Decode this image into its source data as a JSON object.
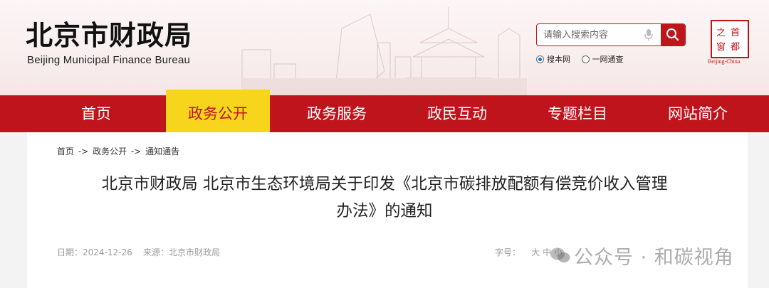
{
  "header": {
    "title": "北京市财政局",
    "subtitle": "Beijing Municipal Finance Bureau",
    "search_placeholder": "请输入搜索内容",
    "radios": [
      "搜本网",
      "一网通查"
    ],
    "seal_chars": [
      "首",
      "都",
      "之",
      "窗"
    ],
    "seal_caption": "Beijing-China"
  },
  "nav": {
    "items": [
      "首页",
      "政务公开",
      "政务服务",
      "政民互动",
      "专题栏目",
      "网站简介"
    ],
    "active_index": 1
  },
  "breadcrumb": {
    "home": "首页",
    "sep": "->",
    "level1": "政务公开",
    "level2": "通知通告"
  },
  "article": {
    "title_line1": "北京市财政局 北京市生态环境局关于印发《北京市碳排放配额有偿竞价收入管理",
    "title_line2": "办法》的通知",
    "date_label": "日期：",
    "date": "2024-12-26",
    "source_label": "来源：",
    "source": "北京市财政局",
    "font_label": "字号：",
    "font_sizes": [
      "大",
      "中",
      "小"
    ]
  },
  "watermark": "公众号 · 和碳视角",
  "colors": {
    "brand_red": "#c0141d",
    "nav_active": "#f7d51c"
  }
}
